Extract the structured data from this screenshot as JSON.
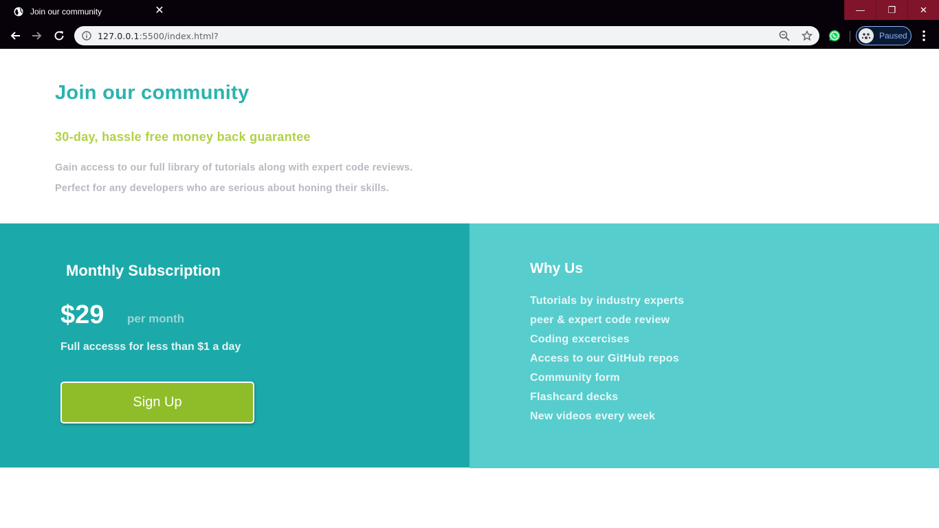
{
  "browser": {
    "tab_title": "Join our community",
    "url_host": "127.0.0.1",
    "url_rest": ":5500/index.html?",
    "profile_status": "Paused",
    "icons": [
      "globe-icon",
      "close-icon",
      "minimize-icon",
      "restore-icon",
      "back-icon",
      "forward-icon",
      "reload-icon",
      "info-icon",
      "zoom-out-icon",
      "star-icon",
      "whatsapp-icon",
      "avatar-icon",
      "menu-dots-icon"
    ]
  },
  "hero": {
    "title": "Join our community",
    "subtitle": "30-day, hassle free money back guarantee",
    "desc_line1": "Gain access to our full library of tutorials along with expert code reviews.",
    "desc_line2": "Perfect for any developers who are serious about honing their skills."
  },
  "subscription": {
    "title": "Monthly Subscription",
    "price": "$29",
    "period": "per month",
    "note": "Full accesss for less than $1 a day",
    "cta": "Sign Up"
  },
  "why": {
    "title": "Why Us",
    "items": [
      "Tutorials by industry experts",
      "peer & expert code review",
      "Coding excercises",
      "Access to our GitHub repos",
      "Community form",
      "Flashcard decks",
      "New videos every week"
    ]
  },
  "colors": {
    "heading_teal": "#2bb3ae",
    "accent_green": "#b0d147",
    "panel_dark": "#1ca9a9",
    "panel_light": "#57cdcd",
    "button_green": "#8fbd2a"
  }
}
